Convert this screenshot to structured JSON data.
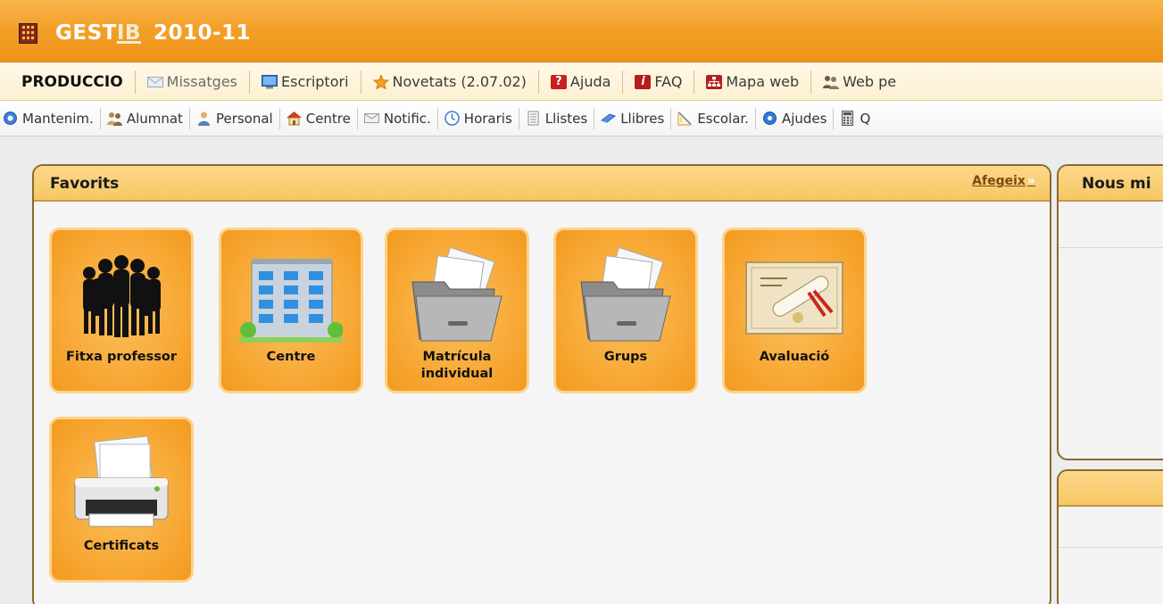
{
  "app": {
    "title_main": "GEST",
    "title_ib": "IB",
    "title_year": "2010-11"
  },
  "menubar": {
    "items": [
      {
        "label": "PRODUCCIO",
        "icon": "none"
      },
      {
        "label": "Missatges",
        "icon": "envelope-icon"
      },
      {
        "label": "Escriptori",
        "icon": "desktop-icon"
      },
      {
        "label": "Novetats (2.07.02)",
        "icon": "star-icon"
      },
      {
        "label": "Ajuda",
        "icon": "help-icon"
      },
      {
        "label": "FAQ",
        "icon": "info-icon"
      },
      {
        "label": "Mapa web",
        "icon": "sitemap-icon"
      },
      {
        "label": "Web pe",
        "icon": "people-icon"
      }
    ]
  },
  "toolbar": {
    "items": [
      {
        "label": "Mantenim.",
        "icon": "maintenance-icon"
      },
      {
        "label": "Alumnat",
        "icon": "students-icon"
      },
      {
        "label": "Personal",
        "icon": "staff-icon"
      },
      {
        "label": "Centre",
        "icon": "home-icon"
      },
      {
        "label": "Notific.",
        "icon": "mail-icon"
      },
      {
        "label": "Horaris",
        "icon": "clock-icon"
      },
      {
        "label": "Llistes",
        "icon": "list-icon"
      },
      {
        "label": "Llibres",
        "icon": "book-icon"
      },
      {
        "label": "Escolar.",
        "icon": "ruler-icon"
      },
      {
        "label": "Ajudes",
        "icon": "globe-icon"
      },
      {
        "label": "Q",
        "icon": "calculator-icon"
      }
    ]
  },
  "favorites": {
    "title": "Favorits",
    "add_label": "Afegeix",
    "add_arrow": "»",
    "tiles": [
      {
        "label": "Fitxa professor",
        "icon": "people-silhouette-icon"
      },
      {
        "label": "Centre",
        "icon": "building-icon"
      },
      {
        "label": "Matrícula individual",
        "icon": "folder-documents-icon"
      },
      {
        "label": "Grups",
        "icon": "folder-documents-icon"
      },
      {
        "label": "Avaluació",
        "icon": "certificate-icon"
      },
      {
        "label": "Certificats",
        "icon": "printer-icon"
      }
    ]
  },
  "news": {
    "title": "Nous mi"
  },
  "colors": {
    "header_orange": "#f3a02a",
    "tile_orange": "#f6a32d",
    "panel_head": "#f7c765",
    "panel_border": "#8b6a2f"
  }
}
